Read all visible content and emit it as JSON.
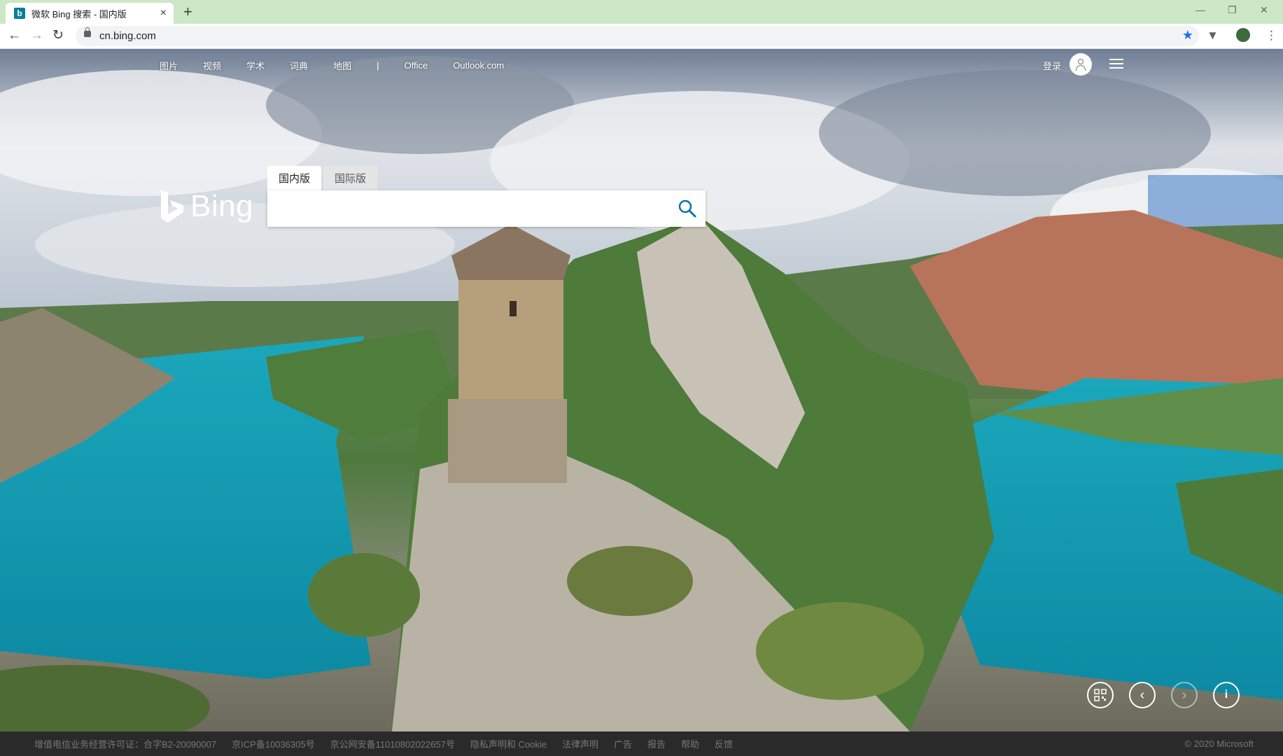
{
  "browser": {
    "tab_title": "微软 Bing 搜索 - 国内版",
    "url": "cn.bing.com",
    "new_tab_label": "+",
    "close_tab_label": "×"
  },
  "nav": {
    "items": [
      "图片",
      "视频",
      "学术",
      "词典",
      "地图"
    ],
    "separator": "|",
    "extra": [
      "Office",
      "Outlook.com"
    ],
    "signin": "登录"
  },
  "logo": {
    "text": "Bing"
  },
  "search": {
    "tabs": [
      "国内版",
      "国际版"
    ],
    "active_tab": "国内版",
    "query": "",
    "placeholder": ""
  },
  "controls": {
    "qr": "qr-code-icon",
    "prev": "chevron-left-icon",
    "next": "chevron-right-icon",
    "info": "info-icon"
  },
  "footer": {
    "links": [
      "增值电信业务经营许可证：合字B2-20090007",
      "京ICP备10036305号",
      "京公网安备11010802022657号",
      "隐私声明和 Cookie",
      "法律声明",
      "广告",
      "报告",
      "帮助",
      "反馈"
    ],
    "copyright": "© 2020 Microsoft"
  },
  "colors": {
    "tabbar_bg": "#cce8c6",
    "water": "#1aa6b7",
    "footer_bg": "#2a2a2a",
    "bing_accent": "#00809d"
  }
}
